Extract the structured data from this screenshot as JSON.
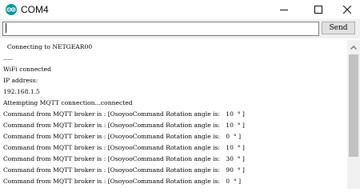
{
  "window": {
    "title": "COM4",
    "icon": "arduino-icon",
    "controls": [
      "minimize-icon",
      "maximize-icon",
      "close-icon"
    ]
  },
  "input": {
    "value": "",
    "placeholder": ""
  },
  "send_button": {
    "label": "Send"
  },
  "console": {
    "lines": [
      "  Connecting to NETGEAR00",
      ".....",
      "WiFi connected",
      "IP address:",
      "192.168.1.5",
      "Attempting MQTT connection...connected",
      "Command from MQTT broker is : [OsoyooCommand Rotation angle is:   10  ° ]",
      "Command from MQTT broker is : [OsoyooCommand Rotation angle is:   10  ° ]",
      "Command from MQTT broker is : [OsoyooCommand Rotation angle is:   0  ° ]",
      "Command from MQTT broker is : [OsoyooCommand Rotation angle is:   10  ° ]",
      "Command from MQTT broker is : [OsoyooCommand Rotation angle is:   30  ° ]",
      "Command from MQTT broker is : [OsoyooCommand Rotation angle is:   90  ° ]",
      "Command from MQTT broker is : [OsoyooCommand Rotation angle is:   0  ° ]"
    ]
  },
  "colors": {
    "app_icon": "#00979c",
    "chrome": "#f0f0f0",
    "console_bg": "#ffffff",
    "scroll_thumb": "#c1c1c1"
  }
}
